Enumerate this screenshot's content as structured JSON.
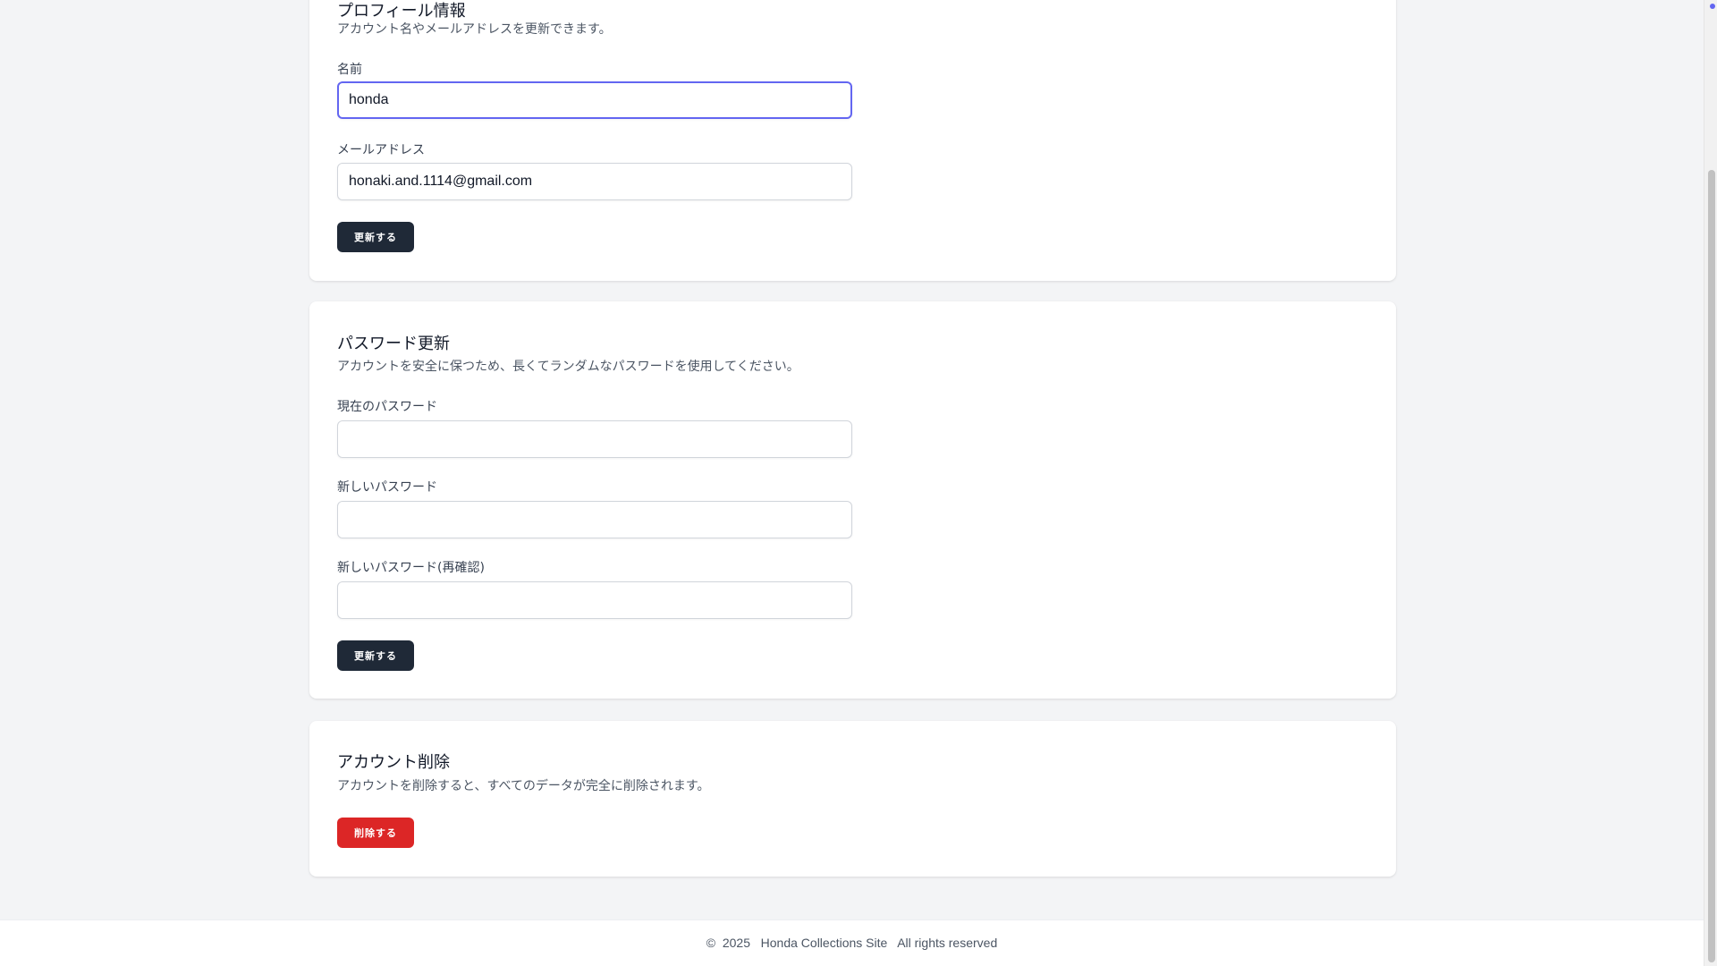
{
  "profile": {
    "title": "プロフィール情報",
    "description": "アカウント名やメールアドレスを更新できます。",
    "name_label": "名前",
    "name_value": "honda",
    "email_label": "メールアドレス",
    "email_value": "honaki.and.1114@gmail.com",
    "submit_label": "更新する"
  },
  "password": {
    "title": "パスワード更新",
    "description": "アカウントを安全に保つため、長くてランダムなパスワードを使用してください。",
    "current_label": "現在のパスワード",
    "current_value": "",
    "new_label": "新しいパスワード",
    "new_value": "",
    "confirm_label": "新しいパスワード(再確認)",
    "confirm_value": "",
    "submit_label": "更新する"
  },
  "delete_account": {
    "title": "アカウント削除",
    "description": "アカウントを削除すると、すべてのデータが完全に削除されます。",
    "delete_label": "削除する"
  },
  "footer": {
    "text": "©  2025   Honda Collections Site   All rights reserved"
  },
  "colors": {
    "primary_button": "#1f2937",
    "danger_button": "#dc2626",
    "focus_ring": "#6366f1"
  }
}
